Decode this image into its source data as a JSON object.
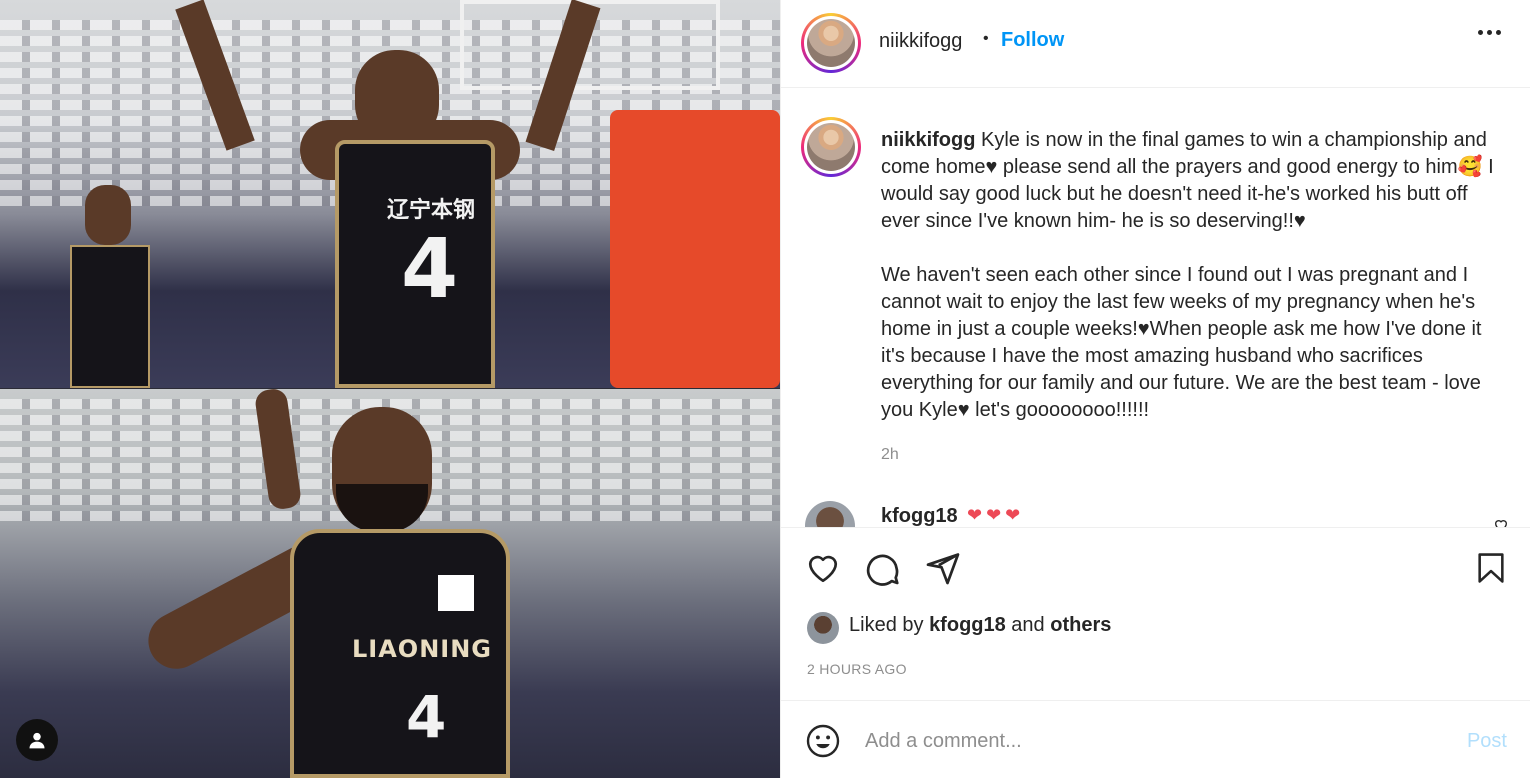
{
  "header": {
    "username": "niikkifogg",
    "separator": "•",
    "follow_label": "Follow"
  },
  "media": {
    "top_jersey_text": "辽宁本钢",
    "top_jersey_number": "4",
    "bottom_jersey_text": "LIAONING",
    "bottom_jersey_number": "4",
    "user_tag_icon": "person-icon"
  },
  "caption": {
    "username": "niikkifogg",
    "text": " Kyle is now in the final games to win a championship and come home♥ please send all the prayers and good energy to him🥰 I would say good luck but he doesn't need it-he's worked his butt off ever since I've known him- he is so deserving!!♥\n\nWe haven't seen each other since I found out I was pregnant and I cannot wait to enjoy the last few weeks of my pregnancy when he's home in just a couple weeks!♥When people ask me how I've done it it's because I have the most amazing husband who sacrifices everything for our family and our future. We are the best team - love you Kyle♥ let's goooooooo!!!!!!",
    "time": "2h"
  },
  "reply": {
    "username": "kfogg18",
    "hearts": "❤❤❤"
  },
  "actions": {
    "icons": [
      "heart-icon",
      "comment-icon",
      "share-icon",
      "bookmark-icon"
    ]
  },
  "likes": {
    "prefix": "Liked by ",
    "user": "kfogg18",
    "middle": " and ",
    "others": "others"
  },
  "timestamp": "2 HOURS AGO",
  "add_comment": {
    "placeholder": "Add a comment...",
    "post_label": "Post"
  },
  "colors": {
    "accent": "#0095f6",
    "post_disabled": "#b2dffc",
    "heart_red": "#ed4956"
  }
}
